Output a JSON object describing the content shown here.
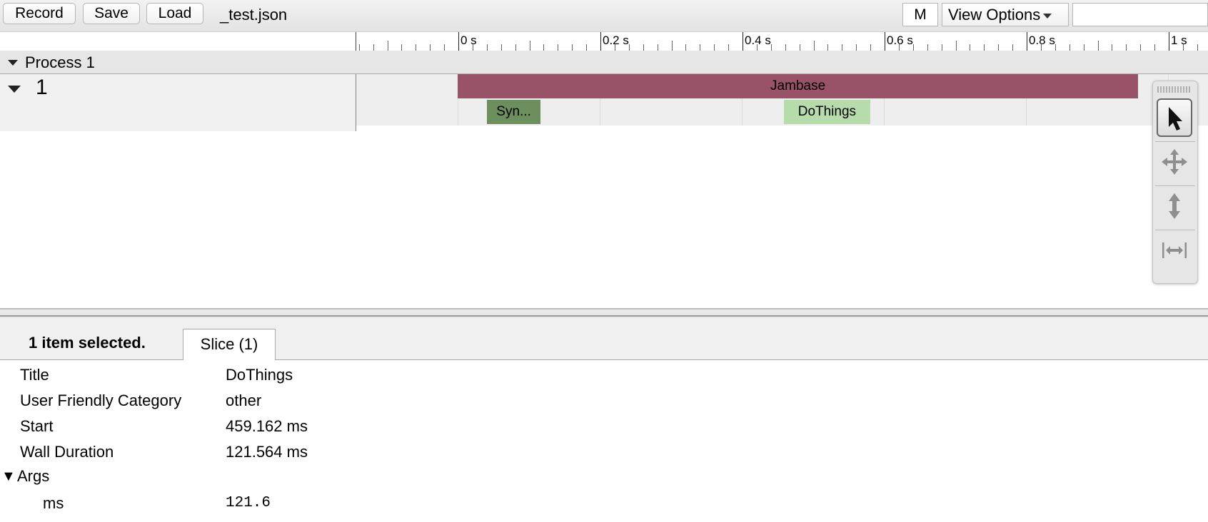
{
  "toolbar": {
    "record_label": "Record",
    "save_label": "Save",
    "load_label": "Load",
    "file_name": "_test.json",
    "m_label": "M",
    "view_options_label": "View Options",
    "search_value": ""
  },
  "ruler": {
    "ticks": [
      "0 s",
      "0.2 s",
      "0.4 s",
      "0.6 s",
      "0.8 s",
      "1 s"
    ]
  },
  "timeline": {
    "process_label": "Process 1",
    "thread_label": "1",
    "slices": [
      {
        "title": "Jambase",
        "start_s": 0.0,
        "end_s": 0.958,
        "row": 0,
        "color": "#985369",
        "text_color": "#000000"
      },
      {
        "title": "Syn...",
        "start_s": 0.041,
        "end_s": 0.117,
        "row": 1,
        "color": "#6c8f5d",
        "text_color": "#000000"
      },
      {
        "title": "DoThings",
        "start_s": 0.459,
        "end_s": 0.581,
        "row": 1,
        "color": "#b5dcaa",
        "text_color": "#000000"
      }
    ]
  },
  "tools": [
    "selection-arrow-icon",
    "pan-icon",
    "zoom-icon",
    "timing-icon"
  ],
  "analysis": {
    "selection_count": "1 item selected.",
    "tab_label": "Slice (1)",
    "props": [
      {
        "name": "Title",
        "value": "DoThings"
      },
      {
        "name": "User Friendly Category",
        "value": "other"
      },
      {
        "name": "Start",
        "value": "459.162 ms"
      },
      {
        "name": "Wall Duration",
        "value": "121.564 ms"
      }
    ],
    "args_label": "Args",
    "args_toggle": "▼",
    "args": [
      {
        "name": "ms",
        "value": "121.6"
      }
    ]
  }
}
